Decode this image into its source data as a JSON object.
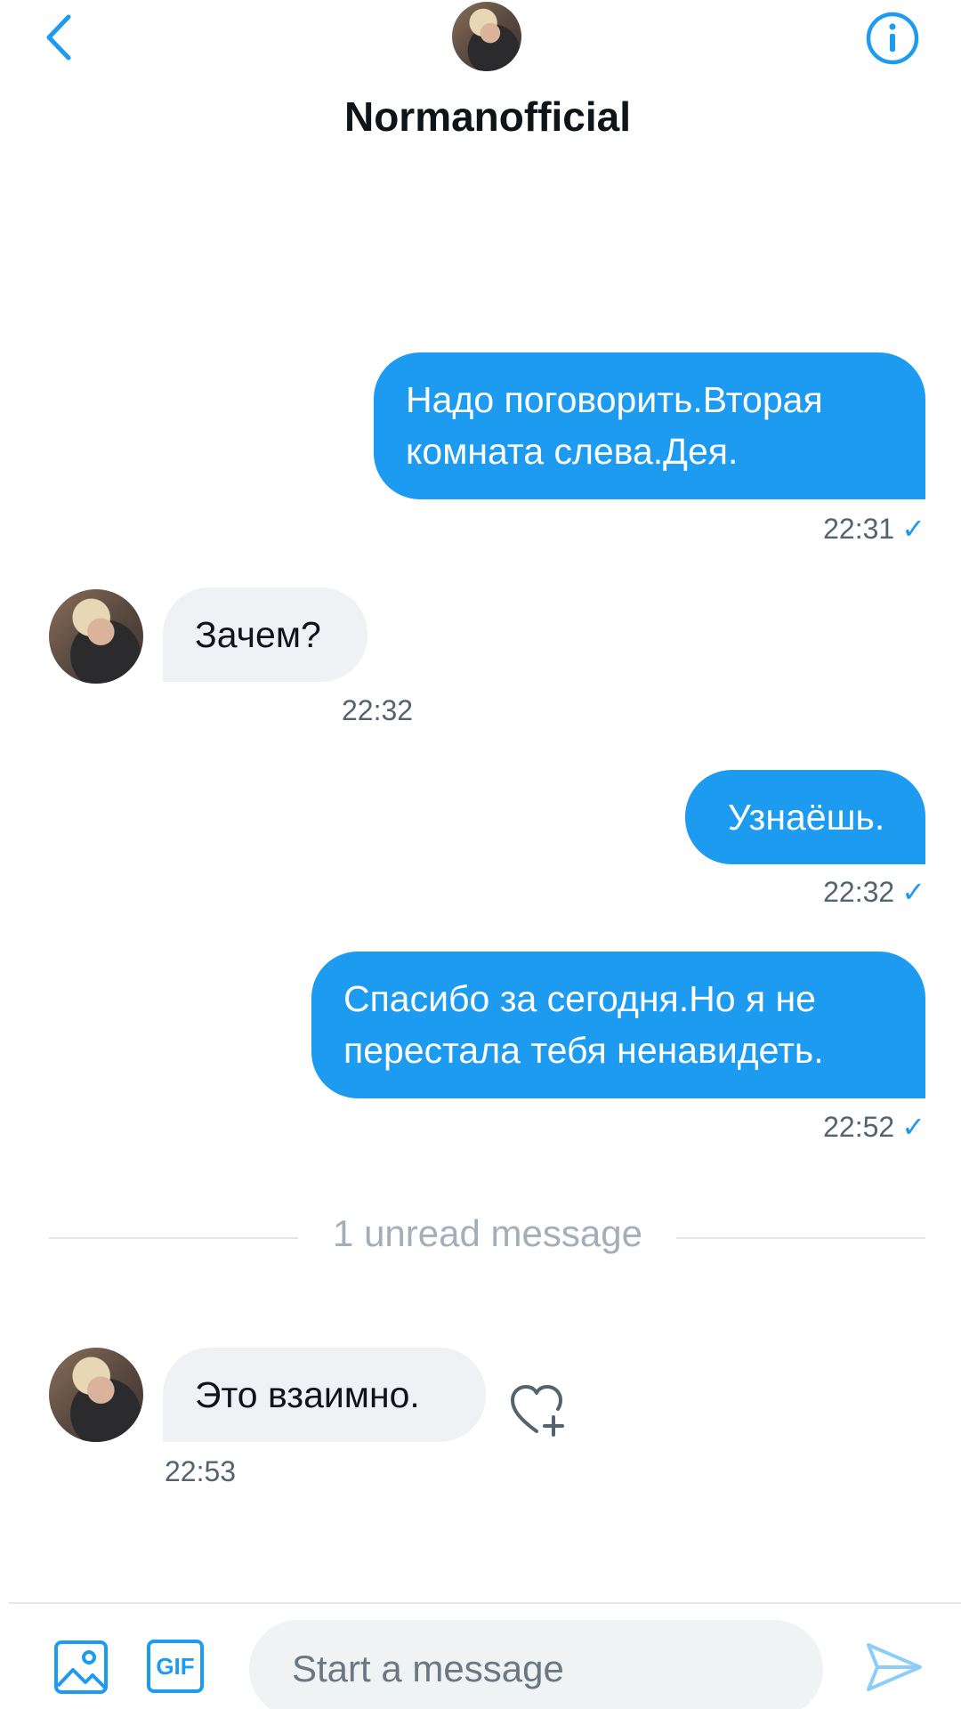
{
  "header": {
    "title": "Normanofficial"
  },
  "messages": [
    {
      "direction": "out",
      "text": "Надо поговорить.Вторая комната слева.Дея.",
      "time": "22:31",
      "read_mark": "✓"
    },
    {
      "direction": "in",
      "text": "Зачем?",
      "time": "22:32"
    },
    {
      "direction": "out",
      "text": "Узнаёшь.",
      "time": "22:32",
      "read_mark": "✓"
    },
    {
      "direction": "out",
      "text": "Спасибо за сегодня.Но я не перестала тебя ненавидеть.",
      "time": "22:52",
      "read_mark": "✓"
    },
    {
      "direction": "in",
      "text": "Это взаимно.",
      "time": "22:53"
    }
  ],
  "unread_divider": "1 unread message",
  "composer": {
    "placeholder": "Start a message",
    "gif_label": "GIF"
  },
  "colors": {
    "accent": "#1d9bf0",
    "incoming_bubble": "#eff1f4",
    "muted_text": "#536471"
  },
  "icons": [
    "back-chevron-icon",
    "info-icon",
    "like-add-icon",
    "image-icon",
    "gif-icon",
    "send-icon"
  ]
}
